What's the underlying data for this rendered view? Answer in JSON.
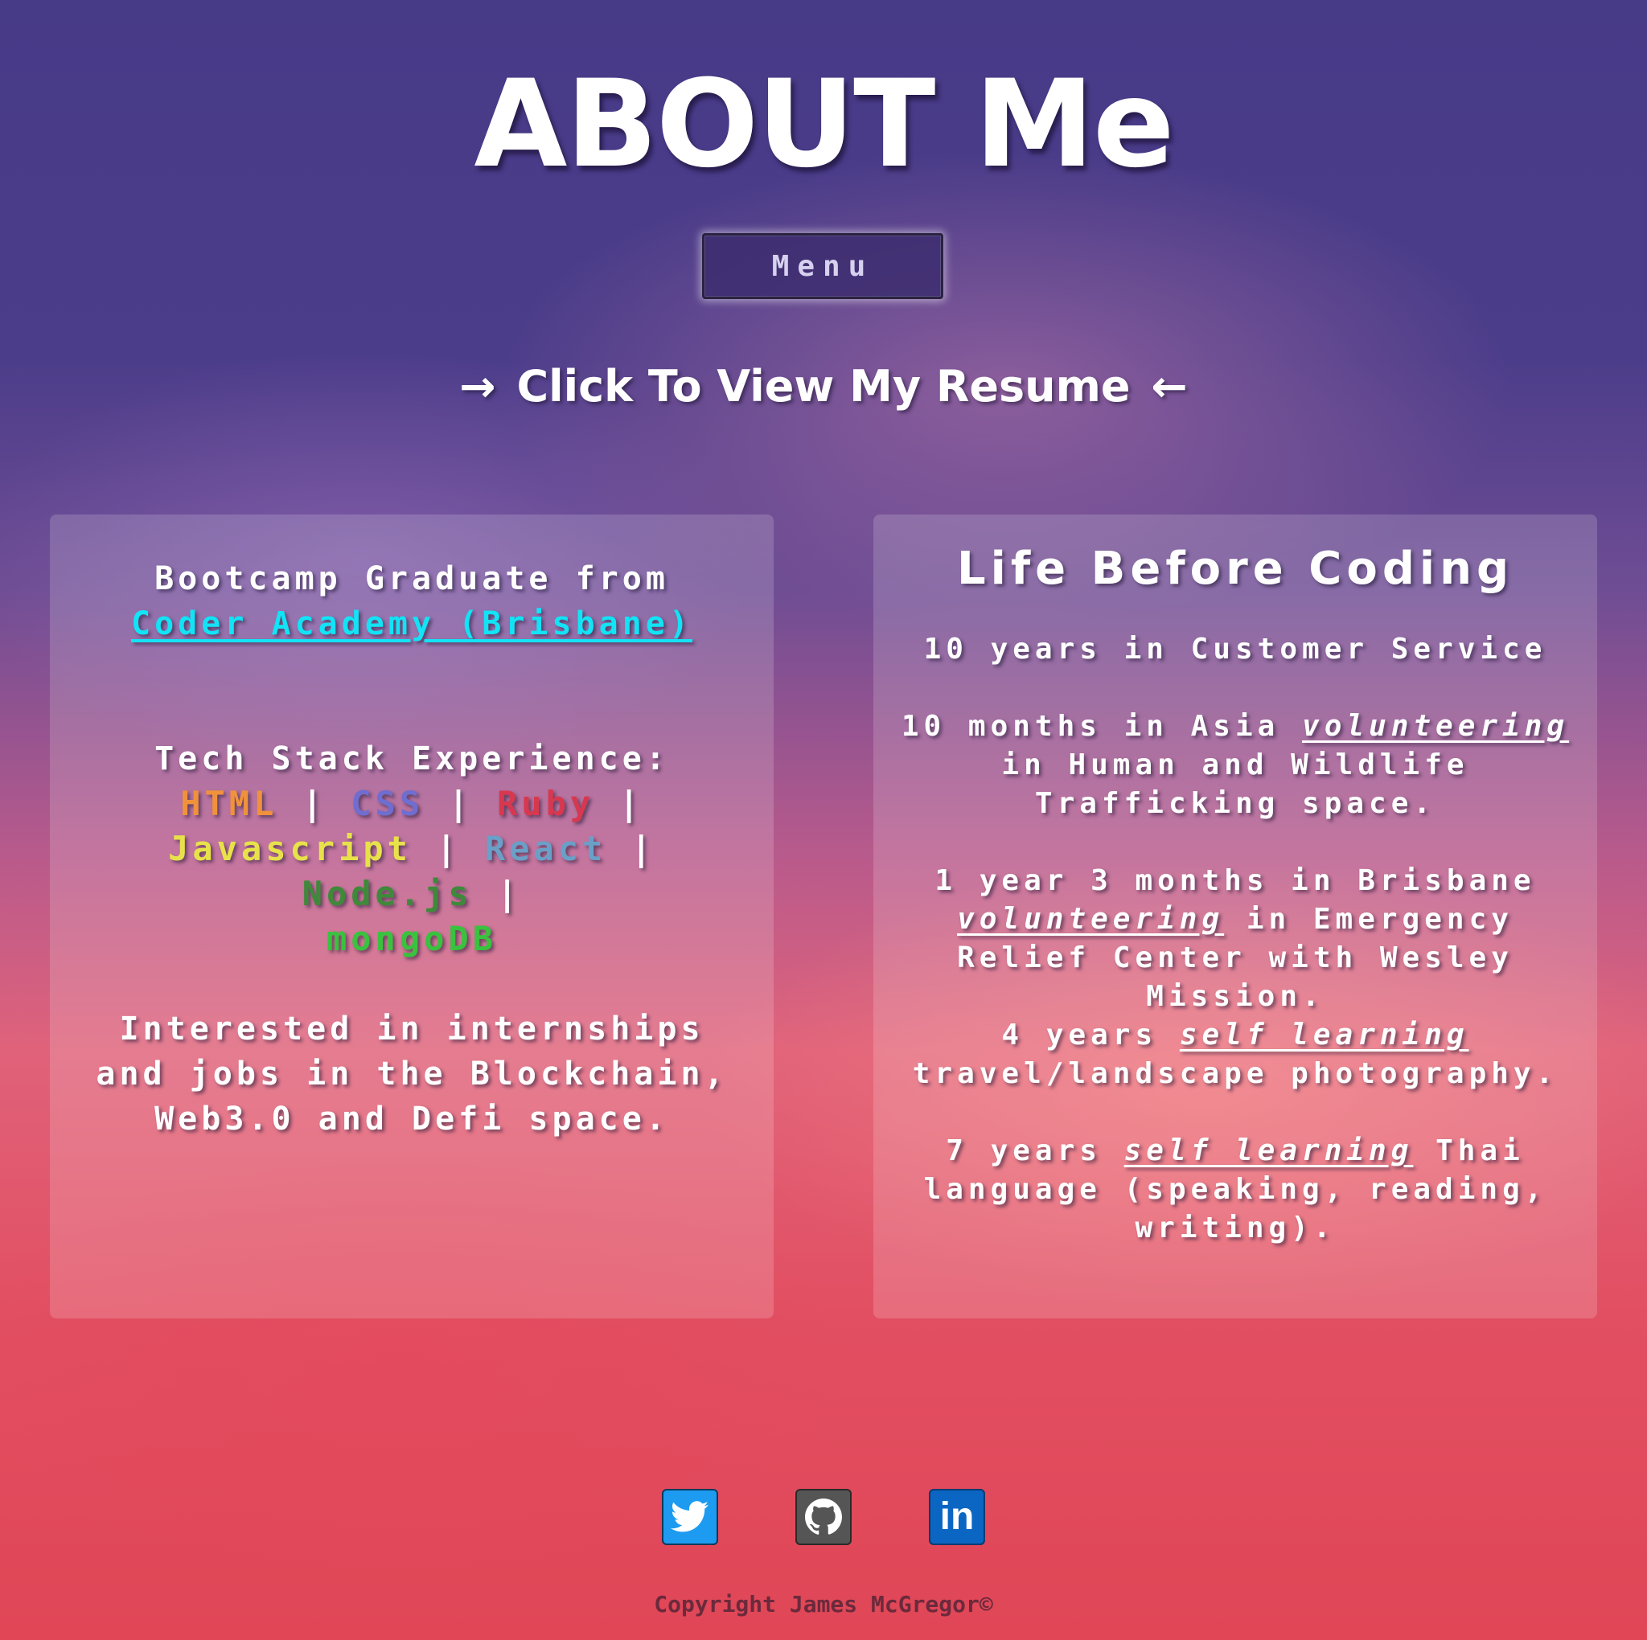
{
  "page": {
    "title": "ABOUT Me",
    "menu_label": "Menu",
    "resume": {
      "arrow_left": "→",
      "label": "Click To View My Resume",
      "arrow_right": "←"
    }
  },
  "left_card": {
    "bootcamp_text": "Bootcamp Graduate from",
    "bootcamp_link": "Coder Academy (Brisbane)",
    "tech_heading": "Tech Stack Experience:",
    "tech": {
      "html": "HTML",
      "css": "CSS",
      "ruby": "Ruby",
      "javascript": "Javascript",
      "react": "React",
      "node": "Node.js",
      "mongo": "mongoDB",
      "separator": "|"
    },
    "interest_text": "Interested in internships and jobs in the Blockchain, Web3.0 and Defi space."
  },
  "right_card": {
    "title": "Life Before Coding",
    "item1": "10 years in Customer Service",
    "item2": {
      "before": "10 months in Asia ",
      "emphasis": "volunteering",
      "after": " in Human and Wildlife Trafficking space."
    },
    "item3": {
      "before": "1 year 3 months in Brisbane ",
      "emphasis": "volunteering",
      "after": " in Emergency Relief Center with Wesley Mission."
    },
    "item4": {
      "before": "4 years ",
      "emphasis": "self learning",
      "after": " travel/landscape photography."
    },
    "item5": {
      "before": "7 years ",
      "emphasis": "self learning",
      "after": " Thai language (speaking, reading, writing)."
    }
  },
  "footer": {
    "socials": [
      {
        "name": "twitter",
        "icon": "twitter-icon",
        "color": "#1d9bf0"
      },
      {
        "name": "github",
        "icon": "github-icon",
        "color": "#555555"
      },
      {
        "name": "linkedin",
        "icon": "linkedin-icon",
        "color": "#0a66c2"
      }
    ],
    "linkedin_glyph": "in",
    "copyright": "Copyright James McGregor©"
  }
}
